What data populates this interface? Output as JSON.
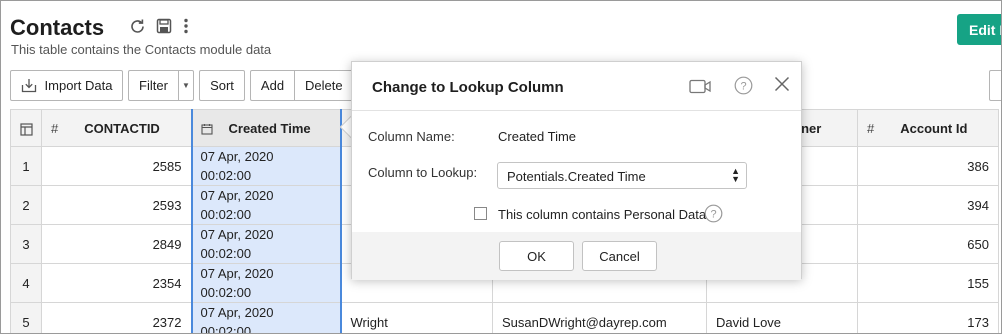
{
  "header": {
    "title": "Contacts",
    "subtitle": "This table contains the Contacts module data",
    "edit_button": "Edit Data",
    "icons": [
      "refresh-icon",
      "save-icon",
      "more-vertical-icon"
    ]
  },
  "toolbar": {
    "import": "Import Data",
    "filter": "Filter",
    "sort": "Sort",
    "add": "Add",
    "delete": "Delete"
  },
  "table": {
    "columns": {
      "contact_id": "CONTACTID",
      "created_time": "Created Time",
      "owner": "wner",
      "account_id": "Account Id",
      "hash": "#"
    },
    "rows": [
      {
        "idx": "1",
        "id": "2585",
        "date": "07 Apr, 2020",
        "time": "00:02:00",
        "a": "",
        "b": "",
        "c": "",
        "acc": "386"
      },
      {
        "idx": "2",
        "id": "2593",
        "date": "07 Apr, 2020",
        "time": "00:02:00",
        "a": "",
        "b": "",
        "c": "",
        "acc": "394"
      },
      {
        "idx": "3",
        "id": "2849",
        "date": "07 Apr, 2020",
        "time": "00:02:00",
        "a": "",
        "b": "",
        "c": "",
        "acc": "650"
      },
      {
        "idx": "4",
        "id": "2354",
        "date": "07 Apr, 2020",
        "time": "00:02:00",
        "a": "",
        "b": "",
        "c": "",
        "acc": "155"
      },
      {
        "idx": "5",
        "id": "2372",
        "date": "07 Apr, 2020",
        "time": "00:02:00",
        "a": "Wright",
        "b": "SusanDWright@dayrep.com",
        "c": "David Love",
        "acc": "173"
      }
    ]
  },
  "dialog": {
    "title": "Change to Lookup Column",
    "column_name_label": "Column Name:",
    "column_name_value": "Created Time",
    "lookup_label": "Column to Lookup:",
    "lookup_value": "Potentials.Created Time",
    "personal_data_label": "This column contains Personal Data",
    "personal_data_checked": false,
    "ok": "OK",
    "cancel": "Cancel"
  }
}
